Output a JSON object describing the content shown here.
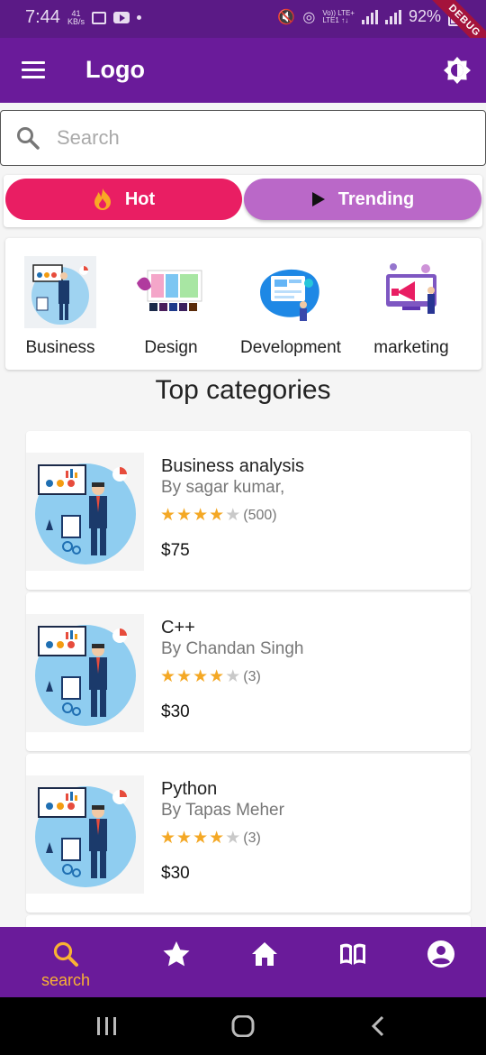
{
  "status_bar": {
    "time": "7:44",
    "net_speed_value": "41",
    "net_speed_unit": "KB/s",
    "lte_line1": "Vo)) LTE+",
    "lte_line2": "LTE1 ↑↓",
    "battery": "92%",
    "debug_banner": "DEBUG"
  },
  "app_bar": {
    "logo": "Logo",
    "menu_icon": "hamburger-menu-icon",
    "theme_icon": "brightness-icon"
  },
  "search": {
    "placeholder": "Search",
    "value": ""
  },
  "tabs": [
    {
      "label": "Hot",
      "icon": "fire-icon",
      "color": "#e91e63"
    },
    {
      "label": "Trending",
      "icon": "play-icon",
      "color": "#ba68c8"
    }
  ],
  "categories": [
    {
      "label": "Business"
    },
    {
      "label": "Design"
    },
    {
      "label": "Development"
    },
    {
      "label": "marketing"
    }
  ],
  "section_title": "Top categories",
  "courses": [
    {
      "title": "Business analysis",
      "author": "By sagar kumar,",
      "rating": 4,
      "rating_count": "(500)",
      "price": "$75"
    },
    {
      "title": "C++",
      "author": "By Chandan Singh",
      "rating": 4,
      "rating_count": "(3)",
      "price": "$30"
    },
    {
      "title": "Python",
      "author": "By Tapas Meher",
      "rating": 4,
      "rating_count": "(3)",
      "price": "$30"
    }
  ],
  "bottom_nav": {
    "items": [
      {
        "label": "search",
        "icon": "search-icon",
        "active": true
      },
      {
        "label": "",
        "icon": "star-icon"
      },
      {
        "label": "",
        "icon": "home-icon"
      },
      {
        "label": "",
        "icon": "book-icon"
      },
      {
        "label": "",
        "icon": "account-icon"
      }
    ],
    "active_color": "#f9b233"
  },
  "colors": {
    "primary": "#6a1b9a",
    "hot": "#e91e63",
    "trending": "#ba68c8",
    "star": "#f4a825"
  }
}
